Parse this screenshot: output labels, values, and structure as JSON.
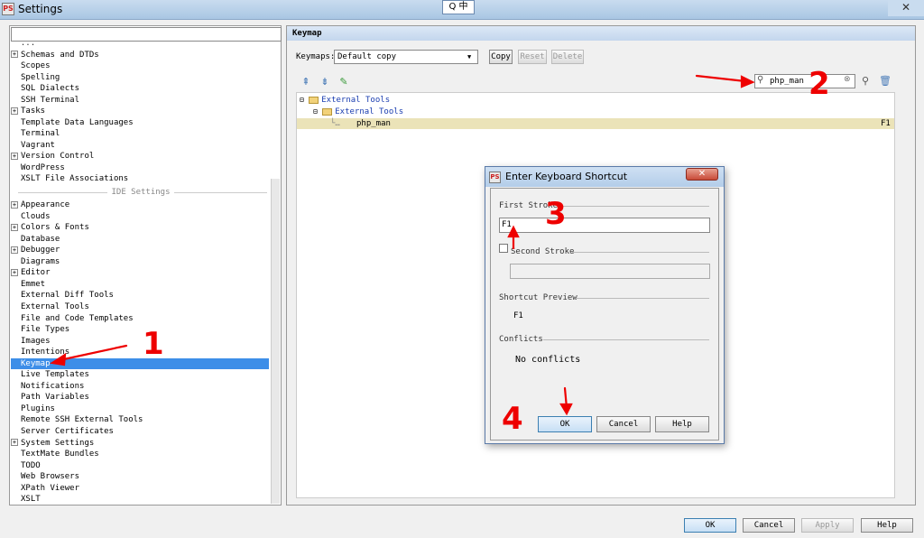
{
  "window": {
    "title": "Settings",
    "app_icon": "PS",
    "ime": "Q 中",
    "close": "✕"
  },
  "sidebar": {
    "items": [
      {
        "label": "???",
        "expandable": false
      },
      {
        "label": "Schemas and DTDs",
        "expandable": true
      },
      {
        "label": "Scopes",
        "expandable": false
      },
      {
        "label": "Spelling",
        "expandable": false
      },
      {
        "label": "SQL Dialects",
        "expandable": false
      },
      {
        "label": "SSH Terminal",
        "expandable": false
      },
      {
        "label": "Tasks",
        "expandable": true
      },
      {
        "label": "Template Data Languages",
        "expandable": false
      },
      {
        "label": "Terminal",
        "expandable": false
      },
      {
        "label": "Vagrant",
        "expandable": false
      },
      {
        "label": "Version Control",
        "expandable": true
      },
      {
        "label": "WordPress",
        "expandable": false
      },
      {
        "label": "XSLT File Associations",
        "expandable": false
      }
    ],
    "ide_header": "IDE Settings",
    "ide_items": [
      {
        "label": "Appearance",
        "expandable": true
      },
      {
        "label": "Clouds",
        "expandable": false
      },
      {
        "label": "Colors & Fonts",
        "expandable": true
      },
      {
        "label": "Database",
        "expandable": false
      },
      {
        "label": "Debugger",
        "expandable": true
      },
      {
        "label": "Diagrams",
        "expandable": false
      },
      {
        "label": "Editor",
        "expandable": true
      },
      {
        "label": "Emmet",
        "expandable": false
      },
      {
        "label": "External Diff Tools",
        "expandable": false
      },
      {
        "label": "External Tools",
        "expandable": false
      },
      {
        "label": "File and Code Templates",
        "expandable": false
      },
      {
        "label": "File Types",
        "expandable": false
      },
      {
        "label": "Images",
        "expandable": false
      },
      {
        "label": "Intentions",
        "expandable": false
      },
      {
        "label": "Keymap",
        "expandable": false,
        "selected": true
      },
      {
        "label": "Live Templates",
        "expandable": false
      },
      {
        "label": "Notifications",
        "expandable": false
      },
      {
        "label": "Path Variables",
        "expandable": false
      },
      {
        "label": "Plugins",
        "expandable": false
      },
      {
        "label": "Remote SSH External Tools",
        "expandable": false
      },
      {
        "label": "Server Certificates",
        "expandable": false
      },
      {
        "label": "System Settings",
        "expandable": true
      },
      {
        "label": "TextMate Bundles",
        "expandable": false
      },
      {
        "label": "TODO",
        "expandable": false
      },
      {
        "label": "Web Browsers",
        "expandable": false
      },
      {
        "label": "XPath Viewer",
        "expandable": false
      },
      {
        "label": "XSLT",
        "expandable": false
      }
    ]
  },
  "keymap": {
    "header": "Keymap",
    "keymaps_label": "Keymaps:",
    "selected_keymap": "Default copy",
    "copy": "Copy",
    "reset": "Reset",
    "delete": "Delete",
    "search_value": "php_man",
    "tree": {
      "root": "External Tools",
      "group": "External Tools",
      "action": "php_man",
      "action_shortcut": "F1"
    }
  },
  "dialog": {
    "title": "Enter Keyboard Shortcut",
    "close": "✕",
    "first_stroke_label": "First Stroke",
    "first_stroke_value": "F1",
    "second_stroke_label": "Second Stroke",
    "second_stroke_checked": false,
    "second_stroke_value": "",
    "preview_label": "Shortcut Preview",
    "preview_value": "F1",
    "conflicts_label": "Conflicts",
    "conflicts_value": "No conflicts",
    "ok": "OK",
    "cancel": "Cancel",
    "help": "Help"
  },
  "footer": {
    "ok": "OK",
    "cancel": "Cancel",
    "apply": "Apply",
    "help": "Help"
  },
  "annotations": [
    "1",
    "2",
    "3",
    "4"
  ],
  "colors": {
    "selection": "#3d8ee8",
    "annotation": "#e00000",
    "tree_highlight": "#ebe3b8"
  }
}
